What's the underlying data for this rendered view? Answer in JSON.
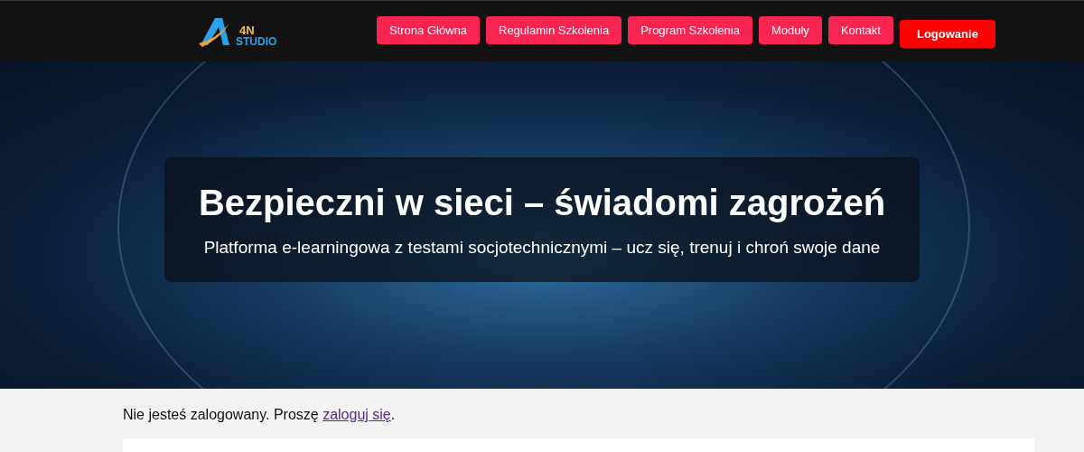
{
  "header": {
    "logo": {
      "top": "4N",
      "bottom": "STUDIO"
    },
    "nav": [
      {
        "label": "Strona Główna",
        "kind": "link"
      },
      {
        "label": "Regulamin Szkolenia",
        "kind": "link"
      },
      {
        "label": "Program Szkolenia",
        "kind": "link"
      },
      {
        "label": "Moduły",
        "kind": "link"
      },
      {
        "label": "Kontakt",
        "kind": "link"
      },
      {
        "label": "Logowanie",
        "kind": "login"
      }
    ]
  },
  "hero": {
    "title": "Bezpieczni w sieci – świadomi zagrożeń",
    "subtitle": "Platforma e-learningowa z testami socjotechnicznymi – ucz się, trenuj i chroń swoje dane"
  },
  "notice": {
    "before": "Nie jesteś zalogowany. Proszę ",
    "link": "zaloguj się",
    "after": "."
  }
}
